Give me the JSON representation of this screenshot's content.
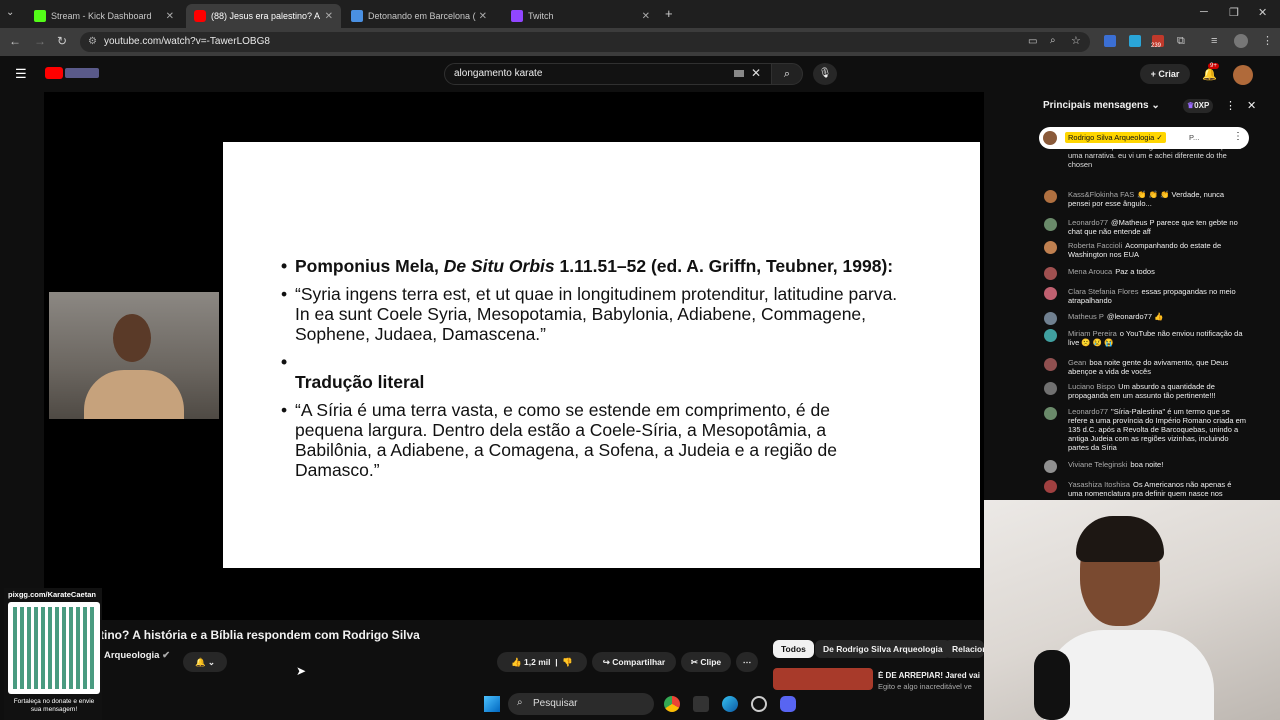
{
  "tabs": [
    {
      "label": "Stream - Kick Dashboard",
      "color": "#53fc18"
    },
    {
      "label": "(88) Jesus era palestino? A",
      "color": "#ff0000"
    },
    {
      "label": "Detonando em Barcelona (",
      "color": "#4a90e2"
    },
    {
      "label": "Twitch",
      "color": "#9146ff"
    }
  ],
  "address": {
    "url": "youtube.com/watch?v=-TawerLOBG8",
    "ext_badge": "239"
  },
  "youtube": {
    "search_value": "alongamento karate",
    "create_label": "Criar",
    "notif_badge": "9+"
  },
  "slide": {
    "line1_a": "Pomponius Mela, ",
    "line1_b": "De Situ Orbis",
    "line1_c": " 1.11.51–52 (ed. A. Griffn, Teubner, 1998):",
    "quote_lat": "“Syria ingens terra est, et ut quae in longitudinem protenditur, latitudine parva.",
    "quote_lat2": "In ea sunt Coele Syria, Mesopotamia, Babylonia, Adiabene, Commagene, Sophene, Judaea, Damascena.”",
    "heading": "Tradução literal",
    "quote_pt": "“A Síria é uma terra vasta, e como se estende em comprimento, é de pequena largura. Dentro dela estão a Coele-Síria, a Mesopotâmia, a Babilônia, a Adiabene, a Comagena, a Sofena, a Judeia e a região de Damasco.”"
  },
  "chat": {
    "header": "Principais mensagens",
    "points": "0XP",
    "pinned_name": "Rodrigo Silva Arqueologia ✓",
    "pinned_extra": "P...",
    "top_fragment": "Austrália os quatro evangelhos sinóticos em apenas uma narrativa. eu vi um e achei diferente do the chosen",
    "messages": [
      {
        "name": "Kass&Flokinha FAS",
        "text": "👏 👏 👏 Verdade, nunca pensei por esse ângulo...",
        "color": "#b07040"
      },
      {
        "name": "Leonardo77",
        "text": "@Matheus P parece que ten gebte no chat que não entende aff",
        "color": "#6a8a6a"
      },
      {
        "name": "Roberta Faccioli",
        "text": "Acompanhando do estate de Washington nos EUA",
        "color": "#c08050"
      },
      {
        "name": "Mena Arouca",
        "text": "Paz a todos",
        "color": "#a05050"
      },
      {
        "name": "Clara Stefania Flores",
        "text": "essas propagandas no meio atrapalhando",
        "color": "#c06070"
      },
      {
        "name": "Matheus P",
        "text": "@leonardo77 👍",
        "color": "#708090"
      },
      {
        "name": "Miriam Pereira",
        "text": "o YouTube não enviou notificação da live 🙁 😢 😭",
        "color": "#40a0a0"
      },
      {
        "name": "Gean",
        "text": "boa noite gente do avivamento, que Deus abençoe a vida de vocês",
        "color": "#905050"
      },
      {
        "name": "Luciano Bispo",
        "text": "Um absurdo a quantidade de propaganda em um assunto tão pertinente!!!",
        "color": "#707070"
      },
      {
        "name": "Leonardo77",
        "text": "\"Síria-Palestina\" é um termo que se refere a uma província do Império Romano criada em 135 d.C. após a Revolta de Barcoquebas, unindo a antiga Judeia com as regiões vizinhas, incluindo partes da Síria",
        "color": "#6a8a6a"
      },
      {
        "name": "Viviane Teleginski",
        "text": "boa noite!",
        "color": "#909090"
      },
      {
        "name": "Yasashiza Itoshisa",
        "text": "Os Americanos não apenas é uma nomenclatura pra definir quem nasce nos",
        "color": "#a04040"
      }
    ]
  },
  "video": {
    "title": "tino? A história e a Bíblia respondem com Rodrigo Silva",
    "channel": "Arqueologia",
    "likes": "1,2 mil",
    "share": "Compartilhar",
    "clip": "Clipe"
  },
  "chips": [
    "Todos",
    "De Rodrigo Silva Arqueologia",
    "Relacion"
  ],
  "related": {
    "title": "É DE ARREPIAR! Jared vai a",
    "sub": "Egito e algo inacreditável ve"
  },
  "overlay": {
    "pix": "pixgg.com/KarateCaetan",
    "caption": "Fortaleça no donate e envie sua mensagem!"
  },
  "taskbar": {
    "search": "Pesquisar"
  }
}
